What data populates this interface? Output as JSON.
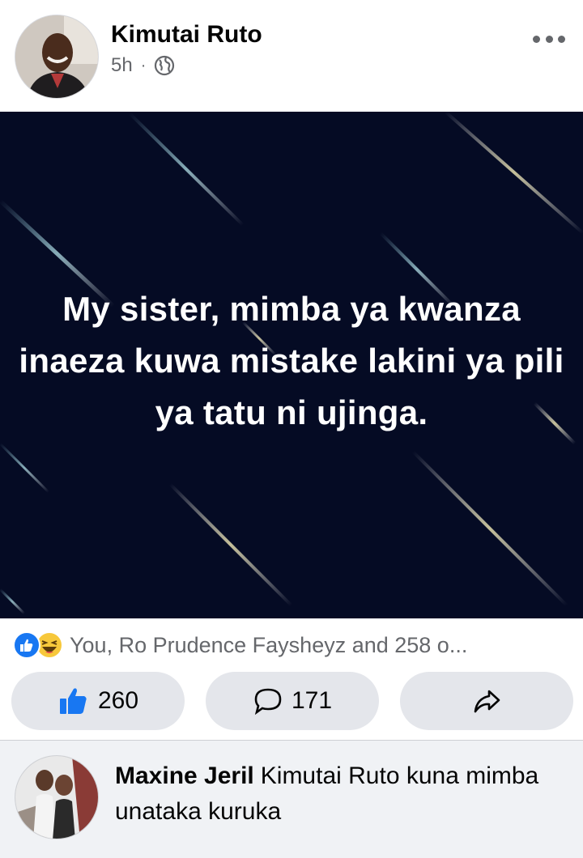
{
  "post": {
    "author": "Kimutai Ruto",
    "time": "5h",
    "separator": "·",
    "audience_icon": "globe-icon",
    "more_icon": "more-options-icon",
    "image_text": "My sister, mimba ya kwanza inaeza kuwa mistake lakini ya pili ya tatu ni ujinga."
  },
  "reactions": {
    "icons": [
      "like-reaction-icon",
      "haha-reaction-icon"
    ],
    "summary": "You, Ro Prudence Faysheyz and 258 o..."
  },
  "actions": {
    "like_count": "260",
    "comment_count": "171",
    "like_icon": "thumbs-up-icon",
    "comment_icon": "comment-bubble-icon",
    "share_icon": "share-arrow-icon"
  },
  "comment": {
    "author": "Maxine Jeril",
    "text": "Kimutai Ruto kuna mimba unataka kuruka"
  },
  "colors": {
    "accent": "#1877f2",
    "image_bg": "#050b24",
    "button_bg": "#e4e6eb",
    "secondary_text": "#65676b",
    "comment_bg": "#f0f2f5"
  }
}
